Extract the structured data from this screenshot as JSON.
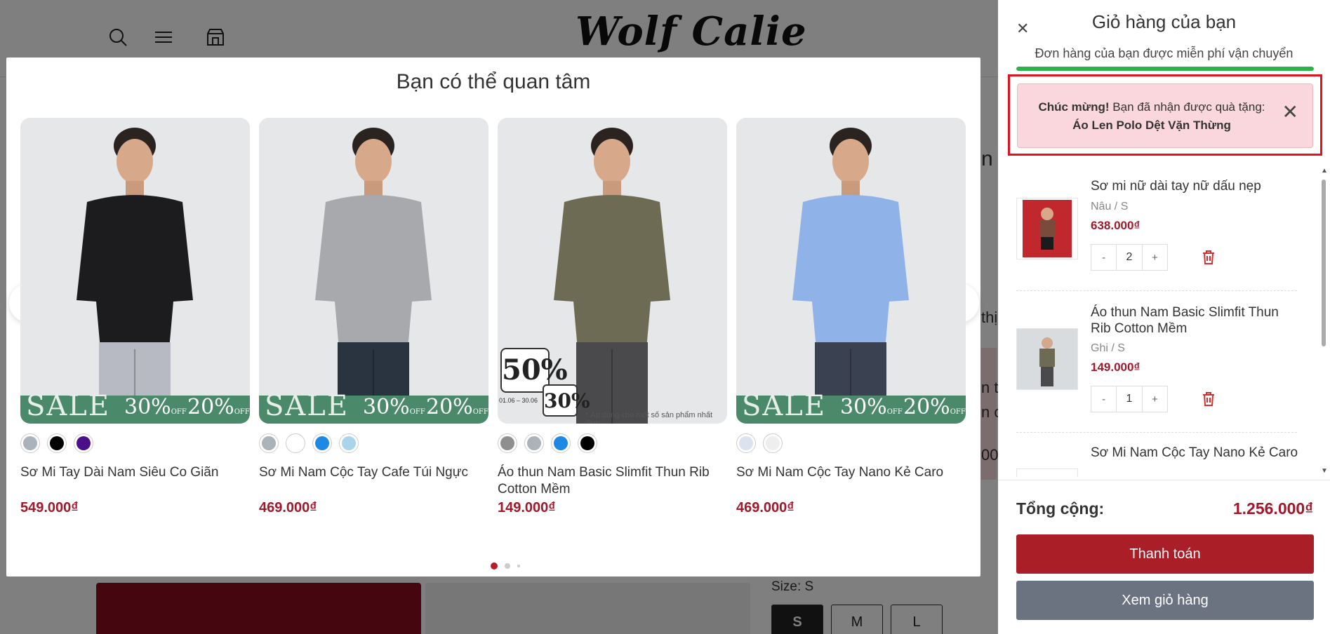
{
  "brand": {
    "logo": "Wolf Calie"
  },
  "background": {
    "size_label": "Size: S",
    "sizes": [
      "S",
      "M",
      "L"
    ],
    "fragments": [
      "n",
      "thị",
      "n từ",
      "n c",
      "00"
    ]
  },
  "modal": {
    "title": "Bạn có thể quan tâm",
    "products": [
      {
        "name": "Sơ Mi Tay Dài Nam Siêu Co Giãn",
        "price": "549.000₫",
        "swatches": [
          "#aab2ba",
          "#000000",
          "#4b0f8a"
        ],
        "shirt_color": "#1c1c1e",
        "pants_color": "#b7bac2",
        "banner": "sale",
        "banner_text": "SALE",
        "pct1": "30%",
        "pct2": "20%",
        "off": "OFF"
      },
      {
        "name": "Sơ Mi Nam Cộc Tay Cafe Túi Ngực",
        "price": "469.000₫",
        "swatches": [
          "#aab2ba",
          "#ffffff",
          "#1e88e5",
          "#a9d4ec"
        ],
        "shirt_color": "#a7a9ac",
        "pants_color": "#2a3340",
        "banner": "sale",
        "banner_text": "SALE",
        "pct1": "30%",
        "pct2": "20%",
        "off": "OFF"
      },
      {
        "name": "Áo thun Nam Basic Slimfit Thun Rib Cotton Mềm",
        "price": "149.000₫",
        "swatches": [
          "#8f8f8f",
          "#aab2ba",
          "#1e88e5",
          "#000000"
        ],
        "shirt_color": "#6e6b55",
        "pants_color": "#4a4a4d",
        "banner": "promo",
        "promo1": "50%",
        "promo2": "30%",
        "promo_date": "01.06 – 30.06",
        "promo_note": "* Áp dụng cho một số sản phẩm nhất định"
      },
      {
        "name": "Sơ Mi Nam Cộc Tay Nano Kẻ Caro",
        "price": "469.000₫",
        "swatches": [
          "#dbe4ee",
          "#eeeeee"
        ],
        "shirt_color": "#8fb2e8",
        "pants_color": "#3a4150",
        "banner": "sale",
        "banner_text": "SALE",
        "pct1": "30%",
        "pct2": "20%",
        "off": "OFF"
      }
    ]
  },
  "cart": {
    "title": "Giỏ hàng của bạn",
    "free_shipping": "Đơn hàng của bạn được miễn phí vận chuyển",
    "progress": 1.0,
    "gift": {
      "strong": "Chúc mừng!",
      "text": " Bạn đã nhận được quà tặng: ",
      "item": "Áo Len Polo Dệt Vặn Thừng"
    },
    "items": [
      {
        "name": "Sơ mi nữ dài tay nữ dấu nẹp",
        "variant": "Nâu / S",
        "price": "638.000₫",
        "qty": "2",
        "thumb_color": "#c0282e"
      },
      {
        "name": "Áo thun Nam Basic Slimfit Thun Rib Cotton Mềm",
        "variant": "Ghi / S",
        "price": "149.000₫",
        "qty": "1",
        "thumb_color": "#d8dcdf"
      },
      {
        "name": "Sơ Mi Nam Cộc Tay Nano Kẻ Caro",
        "variant": "",
        "price": "",
        "qty": "",
        "thumb_color": "#eeeeee"
      }
    ],
    "total_label": "Tổng cộng:",
    "total_value": "1.256.000₫",
    "pay_button": "Thanh toán",
    "view_button": "Xem giỏ hàng"
  },
  "colors": {
    "accent": "#aa1e27",
    "price": "#a0182a",
    "success": "#2bb34a",
    "highlight": "#e0141f"
  }
}
